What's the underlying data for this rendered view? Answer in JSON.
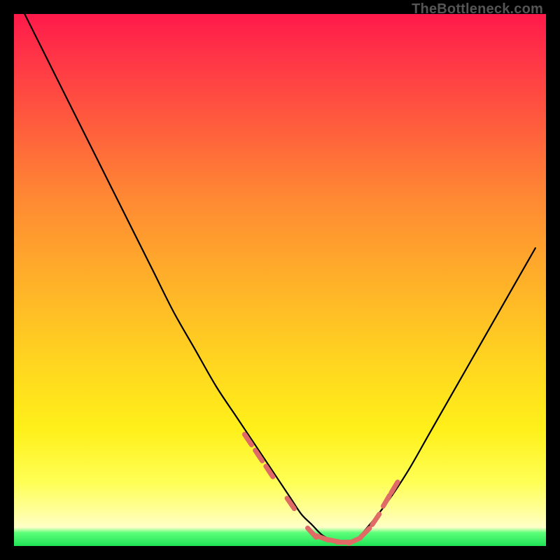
{
  "watermark": "TheBottleneck.com",
  "chart_data": {
    "type": "line",
    "title": "",
    "xlabel": "",
    "ylabel": "",
    "xlim": [
      0,
      100
    ],
    "ylim": [
      0,
      100
    ],
    "grid": false,
    "legend": false,
    "series": [
      {
        "name": "bottleneck-curve",
        "x": [
          2,
          6,
          10,
          14,
          18,
          22,
          26,
          30,
          34,
          38,
          42,
          46,
          50,
          52,
          54,
          56,
          58,
          60,
          62,
          64,
          66,
          70,
          74,
          78,
          82,
          86,
          90,
          94,
          98
        ],
        "y": [
          100,
          92,
          84,
          76,
          68,
          60,
          52,
          44,
          37,
          30,
          24,
          18,
          12,
          9,
          6,
          4,
          2,
          1,
          0.5,
          1,
          3,
          8,
          14,
          21,
          28,
          35,
          42,
          49,
          56
        ]
      }
    ],
    "highlighted_points": {
      "name": "highlight-dashes",
      "color": "#e06a66",
      "x": [
        44,
        46,
        48,
        52,
        56,
        58,
        60,
        62,
        64,
        66,
        68,
        70,
        71.5
      ],
      "y": [
        20,
        17,
        14,
        8,
        2.5,
        1.5,
        1,
        0.7,
        1,
        2.5,
        5,
        8.5,
        11
      ]
    },
    "background_gradient": {
      "direction": "vertical",
      "stops": [
        {
          "pos": 0.0,
          "color": "#ff1a4a"
        },
        {
          "pos": 0.35,
          "color": "#ff8a33"
        },
        {
          "pos": 0.65,
          "color": "#ffd420"
        },
        {
          "pos": 0.88,
          "color": "#ffff55"
        },
        {
          "pos": 0.97,
          "color": "#ffffc8"
        },
        {
          "pos": 1.0,
          "color": "#20e255"
        }
      ]
    }
  }
}
